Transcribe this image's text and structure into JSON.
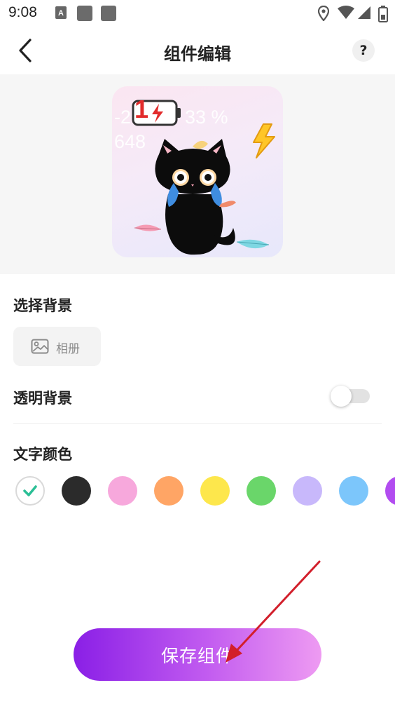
{
  "status_bar": {
    "time": "9:08"
  },
  "nav": {
    "title": "组件编辑",
    "help": "?"
  },
  "widget_preview": {
    "line1": "-2",
    "line1_right": "33 %",
    "line2": "648",
    "battery_digit": "1"
  },
  "background_section": {
    "title": "选择背景",
    "album_label": "相册"
  },
  "transparent_background": {
    "label": "透明背景",
    "enabled": false
  },
  "text_color": {
    "title": "文字颜色",
    "swatches": [
      {
        "name": "white",
        "color": "#ffffff",
        "selected": true
      },
      {
        "name": "black",
        "color": "#2b2b2b",
        "selected": false
      },
      {
        "name": "pink",
        "color": "#f7a8dc",
        "selected": false
      },
      {
        "name": "orange",
        "color": "#ffa565",
        "selected": false
      },
      {
        "name": "yellow",
        "color": "#fde74c",
        "selected": false
      },
      {
        "name": "green",
        "color": "#6ad66a",
        "selected": false
      },
      {
        "name": "lavender",
        "color": "#c8b8fb",
        "selected": false
      },
      {
        "name": "blue",
        "color": "#7cc6fb",
        "selected": false
      },
      {
        "name": "purple",
        "color": "#b24cf0",
        "selected": false
      }
    ],
    "check_color": "#2bbf96"
  },
  "save_button": {
    "label": "保存组件"
  },
  "colors": {
    "annotation_arrow": "#d21f2b"
  }
}
